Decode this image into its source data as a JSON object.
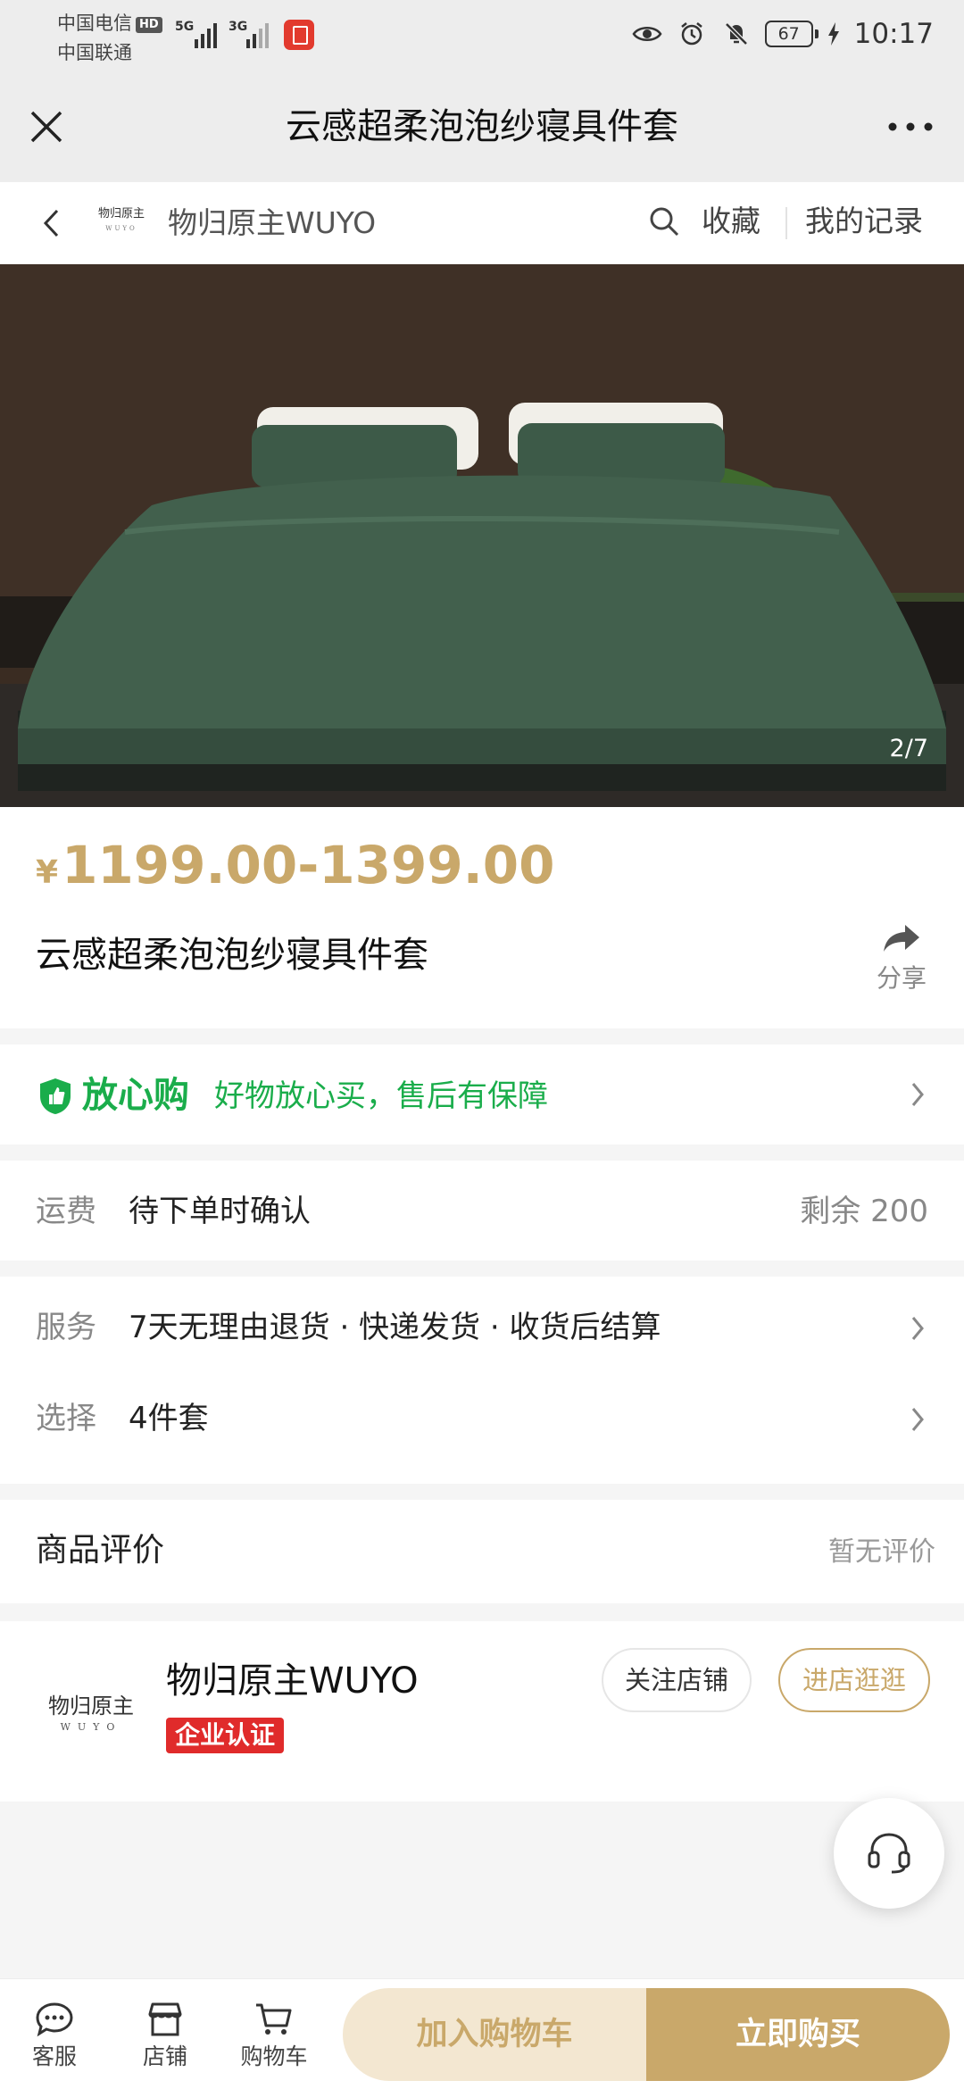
{
  "status_bar": {
    "carrier_1": "中国电信",
    "carrier_1_badge": "HD",
    "carrier_2": "中国联通",
    "signal_1": "5G",
    "signal_2": "3G",
    "battery": "67",
    "time": "10:17"
  },
  "title_bar": {
    "title": "云感超柔泡泡纱寝具件套"
  },
  "shop_nav": {
    "shop_name": "物归原主WUYO",
    "favorite_label": "收藏",
    "records_label": "我的记录"
  },
  "gallery": {
    "counter": "2/7"
  },
  "product": {
    "currency": "¥",
    "price_range": "1199.00-1399.00",
    "title": "云感超柔泡泡纱寝具件套",
    "share_label": "分享"
  },
  "guarantee": {
    "brand": "放心购",
    "text": "好物放心买，售后有保障"
  },
  "details": {
    "shipping_label": "运费",
    "shipping_value": "待下单时确认",
    "stock_text": "剩余 200",
    "service_label": "服务",
    "service_value": "7天无理由退货 · 快递发货 · 收货后结算",
    "option_label": "选择",
    "option_value": "4件套"
  },
  "reviews": {
    "title": "商品评价",
    "empty_text": "暂无评价"
  },
  "shop_card": {
    "logo_text": "物归原主",
    "logo_sub": "WUYO",
    "name": "物归原主WUYO",
    "badge": "企业认证",
    "follow_label": "关注店铺",
    "visit_label": "进店逛逛"
  },
  "bottom_bar": {
    "service_label": "客服",
    "shop_label": "店铺",
    "cart_label": "购物车",
    "add_to_cart_label": "加入购物车",
    "buy_now_label": "立即购买"
  },
  "colors": {
    "accent_gold": "#c9a86a",
    "guarantee_green": "#1aad4b",
    "badge_red": "#e02b2b"
  }
}
